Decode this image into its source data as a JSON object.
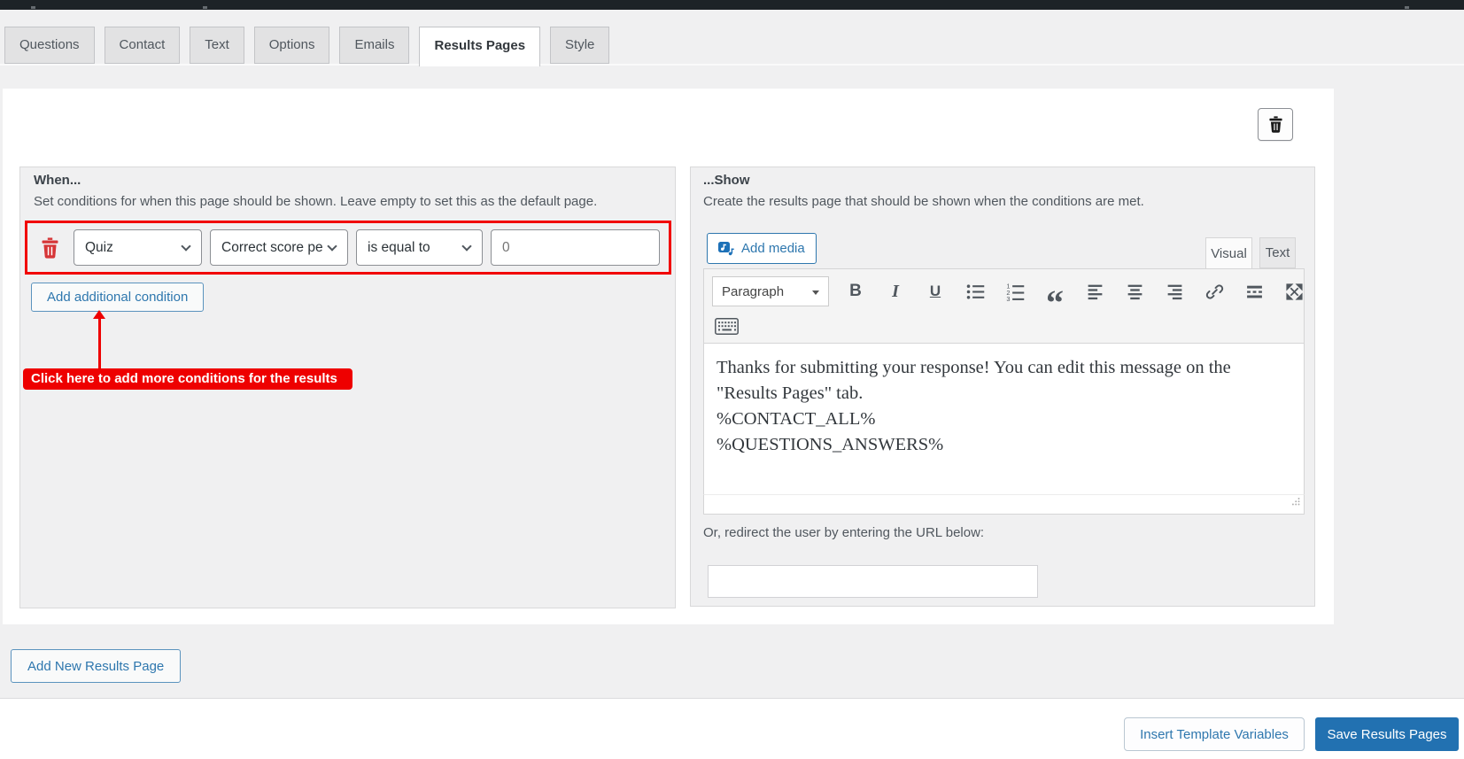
{
  "nav_tabs": {
    "items": [
      {
        "label": "Questions",
        "active": false
      },
      {
        "label": "Contact",
        "active": false
      },
      {
        "label": "Text",
        "active": false
      },
      {
        "label": "Options",
        "active": false
      },
      {
        "label": "Emails",
        "active": false
      },
      {
        "label": "Results Pages",
        "active": true
      },
      {
        "label": "Style",
        "active": false
      }
    ]
  },
  "results_page_card": {
    "delete_page_icon": "trash-icon",
    "when_panel": {
      "title": "When...",
      "description": "Set conditions for when this page should be shown. Leave empty to set this as the default page.",
      "condition_row": {
        "delete_icon": "trash-icon",
        "target_select": "Quiz",
        "field_select": "Correct score pe",
        "comparison_select": "is equal to",
        "value_input": "0"
      },
      "add_condition_button": "Add additional condition",
      "annotation_label": "Click here to add more conditions for the results"
    },
    "show_panel": {
      "title": "...Show",
      "description": "Create the results page that should be shown when the conditions are met.",
      "add_media_button": "Add media",
      "editor_mode_tabs": [
        {
          "label": "Visual",
          "active": true
        },
        {
          "label": "Text",
          "active": false
        }
      ],
      "toolbar": {
        "block_format": "Paragraph",
        "icons": [
          "bold",
          "italic",
          "underline",
          "bulleted-list",
          "numbered-list",
          "blockquote",
          "align-left",
          "align-center",
          "align-right",
          "link",
          "insert-read-more",
          "fullscreen",
          "keyboard-toolbar-toggle"
        ]
      },
      "editor_content_lines": [
        "Thanks for submitting your response! You can edit this message on the",
        "\"Results Pages\" tab.",
        "%CONTACT_ALL%",
        "%QUESTIONS_ANSWERS%"
      ],
      "redirect_label": "Or, redirect the user by entering the URL below:",
      "redirect_url_value": ""
    }
  },
  "add_new_results_page_button": "Add New Results Page",
  "footer": {
    "insert_template_variables_button": "Insert Template Variables",
    "save_button": "Save Results Pages"
  },
  "colors": {
    "accent_blue": "#2271b1",
    "annotation_red": "#ee0000",
    "condition_highlight_red": "#f10000",
    "trash_red": "#d63638",
    "admin_bar": "#1d2327",
    "page_background": "#f0f0f1",
    "card_background": "#ffffff"
  }
}
